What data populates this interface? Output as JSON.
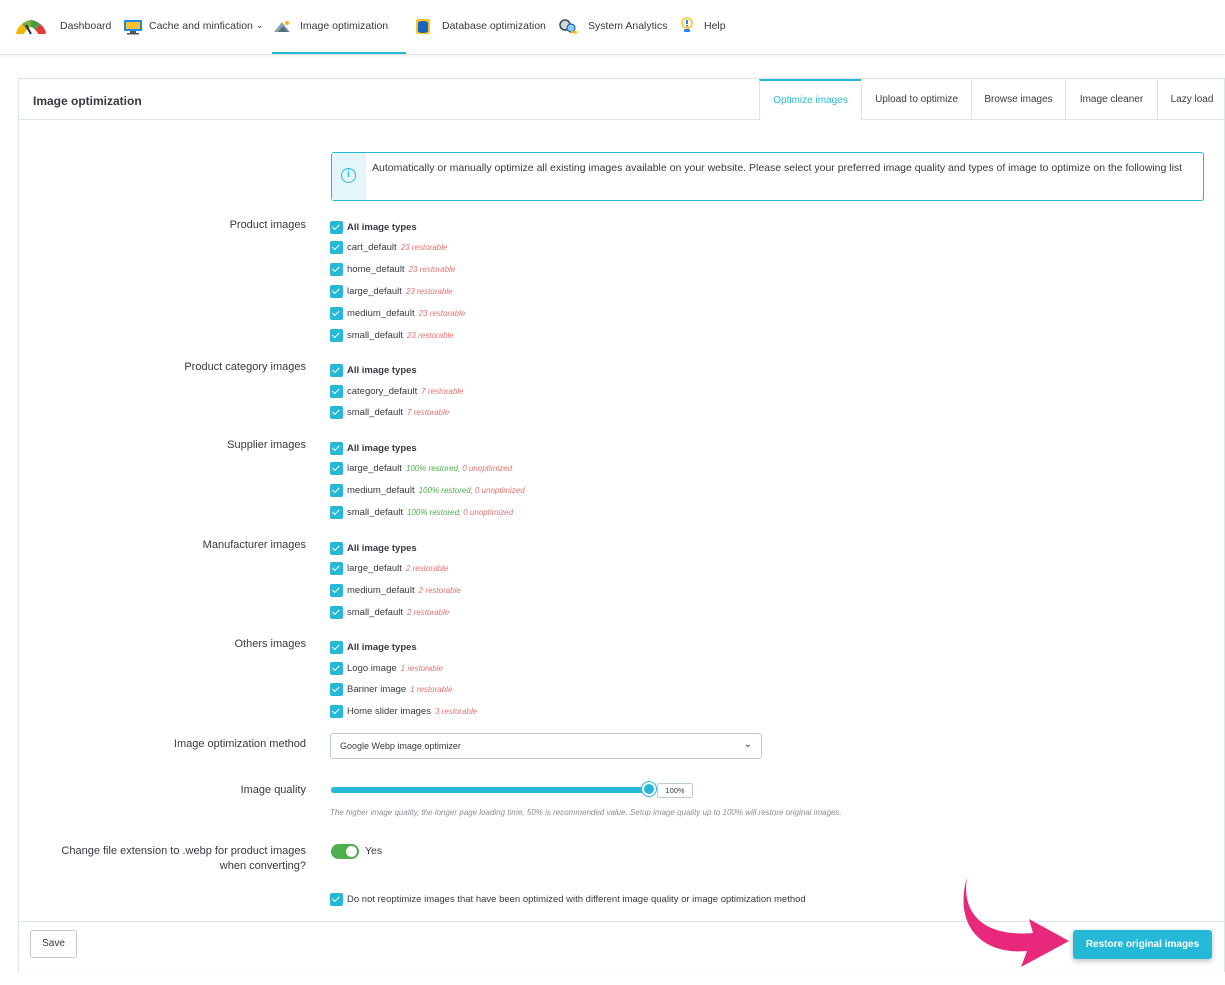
{
  "nav": {
    "items": [
      {
        "label": "Dashboard",
        "icon": "gauge-icon"
      },
      {
        "label": "Cache and minfication",
        "icon": "monitor-icon",
        "caret": "⌄"
      },
      {
        "label": "Image optimization",
        "icon": "image-icon"
      },
      {
        "label": "Database optimization",
        "icon": "database-icon"
      },
      {
        "label": "System Analytics",
        "icon": "analytics-icon"
      },
      {
        "label": "Help",
        "icon": "help-icon"
      }
    ]
  },
  "panel": {
    "title": "Image optimization",
    "tabs": [
      "Optimize images",
      "Upload to optimize",
      "Browse images",
      "Image cleaner",
      "Lazy load"
    ]
  },
  "info": {
    "text": "Automatically or manually optimize all existing images available on your website. Please select your preferred image quality and types of image to optimize on the following list"
  },
  "groups": [
    {
      "label": "Product images",
      "items": [
        {
          "label": "All image types",
          "note": "",
          "bold": true
        },
        {
          "label": "cart_default",
          "note": "23 restorable"
        },
        {
          "label": "home_default",
          "note": "23 restorable"
        },
        {
          "label": "large_default",
          "note": "23 restorable"
        },
        {
          "label": "medium_default",
          "note": "23 restorable"
        },
        {
          "label": "small_default",
          "note": "23 restorable"
        }
      ]
    },
    {
      "label": "Product category images",
      "items": [
        {
          "label": "All image types",
          "note": "",
          "bold": true
        },
        {
          "label": "category_default",
          "note": "7 restorable"
        },
        {
          "label": "small_default",
          "note": "7 restorable"
        }
      ]
    },
    {
      "label": "Supplier images",
      "items": [
        {
          "label": "All image types",
          "note": "",
          "bold": true
        },
        {
          "label": "large_default",
          "note_green": "100% restored,",
          "note_red": "0 unoptimized"
        },
        {
          "label": "medium_default",
          "note_green": "100% restored,",
          "note_red": "0 unoptimized"
        },
        {
          "label": "small_default",
          "note_green": "100% restored,",
          "note_red": "0 unoptimized"
        }
      ]
    },
    {
      "label": "Manufacturer images",
      "items": [
        {
          "label": "All image types",
          "note": "",
          "bold": true
        },
        {
          "label": "large_default",
          "note": "2 restorable"
        },
        {
          "label": "medium_default",
          "note": "2 restorable"
        },
        {
          "label": "small_default",
          "note": "2 restorable"
        }
      ]
    },
    {
      "label": "Others images",
      "items": [
        {
          "label": "All image types",
          "note": "",
          "bold": true
        },
        {
          "label": "Logo image",
          "note": "1 restorable"
        },
        {
          "label": "Banner image",
          "note": "1 restorable"
        },
        {
          "label": "Home slider images",
          "note": "3 restorable"
        }
      ]
    }
  ],
  "method": {
    "label": "Image optimization method",
    "value": "Google Webp image optimizer"
  },
  "quality": {
    "label": "Image quality",
    "value": "100%",
    "level": 1.0,
    "hint": "The higher image quality, the longer page loading time, 50% is recommended value. Setup image quality up to 100% will restore original images."
  },
  "webp": {
    "label_line1": "Change file extension to .webp for product images",
    "label_line2": "when converting?",
    "toggle_label": "Yes"
  },
  "reoptimize": {
    "label": "Do not reoptimize images that have been optimized with different image quality or image optimization method"
  },
  "footer": {
    "save": "Save",
    "restore": "Restore original images"
  },
  "colors": {
    "accent": "#25b9d7",
    "toggle_on": "#4cae4c",
    "restorable": "#e57373",
    "restored": "#4cae4c",
    "arrow": "#e8287a"
  }
}
